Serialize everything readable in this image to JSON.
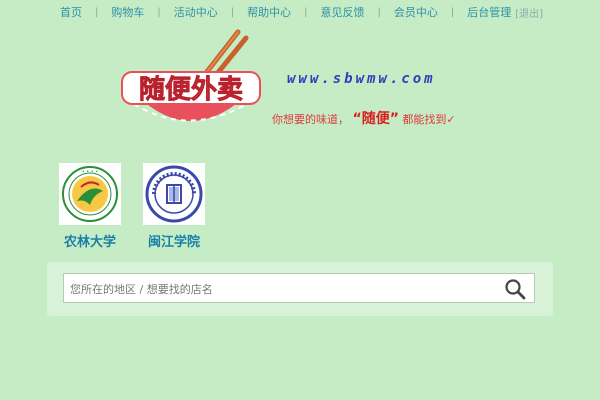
{
  "nav": {
    "items": [
      "首页",
      "购物车",
      "活动中心",
      "帮助中心",
      "意见反馈",
      "会员中心",
      "后台管理"
    ],
    "logout": "[退出]"
  },
  "logo": {
    "text": "随便外卖",
    "url": "www.sbwmw.com",
    "slogan_prefix": "你想要的味道，",
    "slogan_emphasis": "“随便”",
    "slogan_suffix": "都能找到✓"
  },
  "schools": [
    {
      "name": "农林大学",
      "icon": "fafu-seal-icon"
    },
    {
      "name": "闽江学院",
      "icon": "minjiang-university-seal-icon"
    }
  ],
  "search": {
    "placeholder": "您所在的地区 / 想要找的店名",
    "icon": "search-icon"
  },
  "colors": {
    "background": "#c6ecc6",
    "nav_text": "#2f8fa6",
    "logo_red": "#e8505b",
    "url_blue": "#2b3fbf",
    "slogan_red": "#e03a3a",
    "school_name": "#1a7fa6"
  }
}
